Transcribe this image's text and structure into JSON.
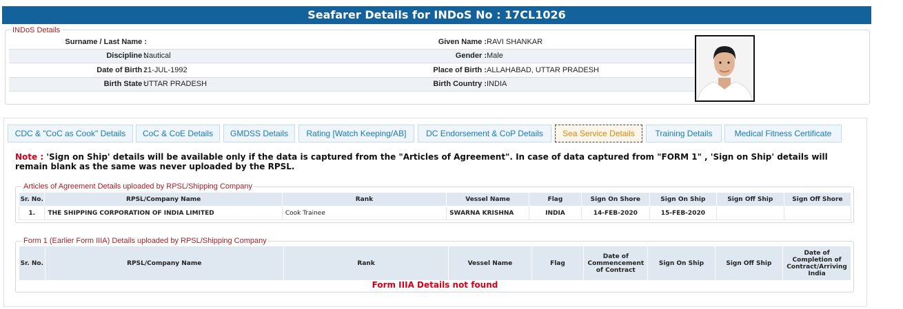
{
  "title": "Seafarer Details for INDoS No : 17CL1026",
  "indos": {
    "legend": "INDoS Details",
    "rows": [
      {
        "l1": "Surname / Last Name :",
        "v1": "",
        "l2": "Given Name :",
        "v2": "RAVI SHANKAR"
      },
      {
        "l1": "Discipline :",
        "v1": "Nautical",
        "l2": "Gender :",
        "v2": "Male"
      },
      {
        "l1": "Date of Birth :",
        "v1": "21-JUL-1992",
        "l2": "Place of Birth :",
        "v2": "ALLAHABAD, UTTAR PRADESH"
      },
      {
        "l1": "Birth State :",
        "v1": "UTTAR PRADESH",
        "l2": "Birth Country :",
        "v2": "INDIA"
      }
    ]
  },
  "tabs": [
    {
      "label": "CDC & \"CoC as Cook\" Details",
      "active": false
    },
    {
      "label": "CoC & CoE Details",
      "active": false
    },
    {
      "label": "GMDSS Details",
      "active": false
    },
    {
      "label": "Rating [Watch Keeping/AB]",
      "active": false
    },
    {
      "label": "DC Endorsement & CoP Details",
      "active": false
    },
    {
      "label": "Sea Service Details",
      "active": true
    },
    {
      "label": "Training Details",
      "active": false
    },
    {
      "label": "Medical Fitness Certificate",
      "active": false
    }
  ],
  "note": {
    "label": "Note :",
    "text": "'Sign on Ship' details will be available only if the data is captured from the \"Articles of Agreement\". In case of data captured from \"FORM 1\" , 'Sign on Ship' details will remain blank as the same was never uploaded by the RPSL."
  },
  "articles": {
    "legend": "Articles of Agreement Details uploaded by RPSL/Shipping Company",
    "headers": [
      "Sr. No.",
      "RPSL/Company Name",
      "Rank",
      "Vessel Name",
      "Flag",
      "Sign On Shore",
      "Sign On Ship",
      "Sign Off Ship",
      "Sign Off Shore"
    ],
    "rows": [
      [
        "1.",
        "THE SHIPPING CORPORATION OF INDIA LIMITED",
        "Cook Trainee",
        "SWARNA KRISHNA",
        "INDIA",
        "14-FEB-2020",
        "15-FEB-2020",
        "",
        ""
      ]
    ]
  },
  "form1": {
    "legend": "Form 1 (Earlier Form IIIA) Details uploaded by RPSL/Shipping Company",
    "headers": [
      "Sr. No.",
      "RPSL/Company Name",
      "Rank",
      "Vessel Name",
      "Flag",
      "Date of Commencement of Contract",
      "Sign On Ship",
      "Sign Off Ship",
      "Date of Completion of Contract/Arriving India"
    ],
    "empty_message": "Form IIIA Details not found"
  }
}
